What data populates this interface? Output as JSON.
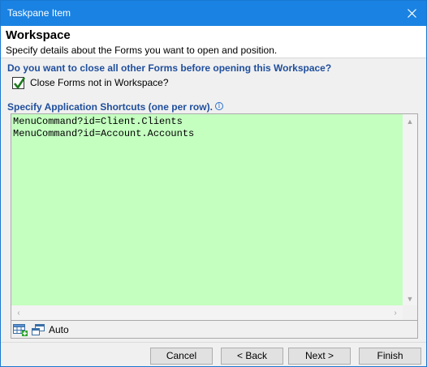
{
  "window": {
    "title": "Taskpane Item"
  },
  "header": {
    "title": "Workspace",
    "subtitle": "Specify details about the Forms you want to open and position."
  },
  "close_forms": {
    "question": "Do you want to close all other Forms before opening this Workspace?",
    "checkbox_label": "Close Forms not in Workspace?",
    "checked": true
  },
  "shortcuts": {
    "label": "Specify Application Shortcuts (one per row).",
    "text": "MenuCommand?id=Client.Clients\nMenuCommand?id=Account.Accounts",
    "background": "#c4ffc0"
  },
  "toolbar": {
    "auto_label": "Auto"
  },
  "buttons": {
    "cancel": "Cancel",
    "back": "< Back",
    "next": "Next >",
    "finish": "Finish"
  },
  "colors": {
    "titlebar": "#1a82e2",
    "section_label": "#1f4e9c",
    "checkmark": "#1b7a1b"
  }
}
